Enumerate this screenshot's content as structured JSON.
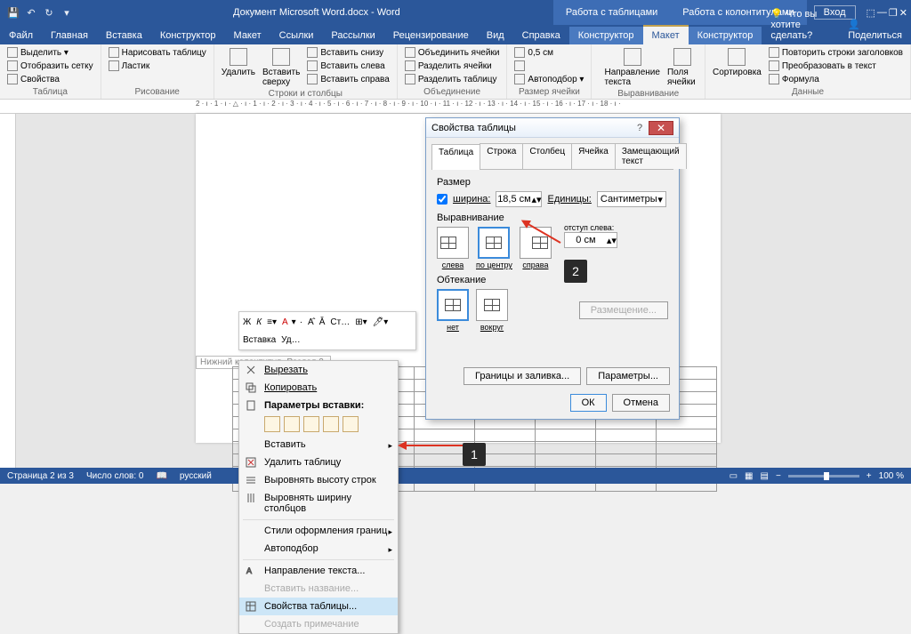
{
  "titlebar": {
    "doc_title": "Документ Microsoft Word.docx  -  Word",
    "ctx1": "Работа с таблицами",
    "ctx2": "Работа с колонтитулами",
    "login": "Вход"
  },
  "tabs": {
    "file": "Файл",
    "home": "Главная",
    "insert": "Вставка",
    "design": "Конструктор",
    "layout": "Макет",
    "refs": "Ссылки",
    "mail": "Рассылки",
    "review": "Рецензирование",
    "view": "Вид",
    "help": "Справка",
    "ctx_design": "Конструктор",
    "ctx_layout": "Макет",
    "ctx_hf_design": "Конструктор",
    "tellme": "Что вы хотите сделать?",
    "share": "Поделиться"
  },
  "ribbon": {
    "g1": {
      "select": "Выделить ▾",
      "grid": "Отобразить сетку",
      "props": "Свойства",
      "label": "Таблица"
    },
    "g2": {
      "draw": "Нарисовать таблицу",
      "eraser": "Ластик",
      "label": "Рисование"
    },
    "g3": {
      "delete": "Удалить",
      "insert_above": "Вставить сверху",
      "below": "Вставить снизу",
      "left": "Вставить слева",
      "right": "Вставить справа",
      "label": "Строки и столбцы"
    },
    "g4": {
      "merge": "Объединить ячейки",
      "split": "Разделить ячейки",
      "split_tbl": "Разделить таблицу",
      "label": "Объединение"
    },
    "g5": {
      "h": "0,5 см",
      "autofit": "Автоподбор ▾",
      "label": "Размер ячейки"
    },
    "g6": {
      "dir": "Направление текста",
      "margins": "Поля ячейки",
      "label": "Выравнивание"
    },
    "g7": {
      "sort": "Сортировка",
      "repeat": "Повторить строки заголовков",
      "convert": "Преобразовать в текст",
      "formula": "Формула",
      "label": "Данные"
    }
  },
  "ruler": "2 · ı · 1 · ı · △ · ı · 1 · ı · 2 · ı · 3 · ı · 4 · ı · 5 · ı · 6 · ı · 7 · ı · 8 · ı · 9 · ı · 10 · ı · 11 · ı · 12 · ı · 13 · ı · 14 · ı · 15 · ı · 16 · ı · 17 · ı · 18 · ı · ",
  "footer_tag": "Нижний колонтитул -Раздел 2-",
  "context_menu": {
    "cut": "Вырезать",
    "copy": "Копировать",
    "paste_label": "Параметры вставки:",
    "insert": "Вставить",
    "delete_tbl": "Удалить таблицу",
    "equal_rows": "Выровнять высоту строк",
    "equal_cols": "Выровнять ширину столбцов",
    "border_styles": "Стили оформления границ",
    "autofit": "Автоподбор",
    "text_dir": "Направление текста...",
    "caption": "Вставить название...",
    "props": "Свойства таблицы...",
    "comment": "Создать примечание"
  },
  "dialog": {
    "title": "Свойства таблицы",
    "tabs": {
      "table": "Таблица",
      "row": "Строка",
      "col": "Столбец",
      "cell": "Ячейка",
      "alt": "Замещающий текст"
    },
    "size_label": "Размер",
    "width_label": "ширина:",
    "width_val": "18,5 см",
    "units_label": "Единицы:",
    "units_val": "Сантиметры",
    "align_label": "Выравнивание",
    "align_left": "слева",
    "align_center": "по центру",
    "align_right": "справа",
    "indent_label": "отступ слева:",
    "indent_val": "0 см",
    "wrap_label": "Обтекание",
    "wrap_none": "нет",
    "wrap_around": "вокруг",
    "position": "Размещение...",
    "borders": "Границы и заливка...",
    "options": "Параметры...",
    "ok": "ОК",
    "cancel": "Отмена"
  },
  "badges": {
    "b1": "1",
    "b2": "2"
  },
  "status": {
    "page": "Страница 2 из 3",
    "words": "Число слов: 0",
    "lang": "русский",
    "zoom": "100 %"
  }
}
